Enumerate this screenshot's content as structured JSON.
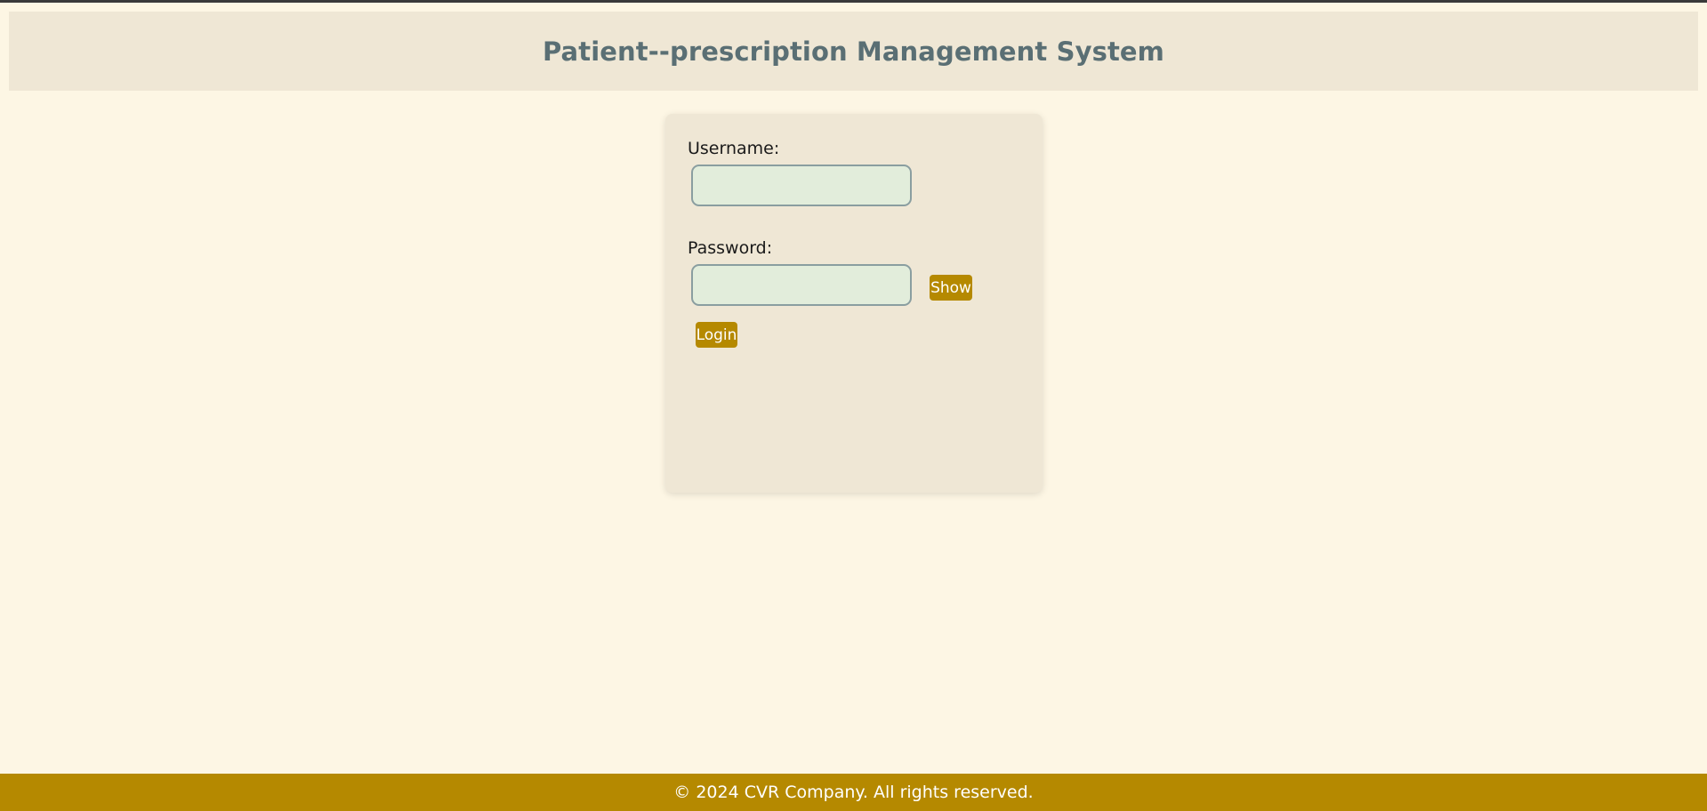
{
  "header": {
    "title": "Patient--prescription Management System"
  },
  "login": {
    "username_label": "Username:",
    "username_value": "",
    "password_label": "Password:",
    "password_value": "",
    "show_label": "Show",
    "login_label": "Login"
  },
  "footer": {
    "copyright": "© 2024 CVR Company. All rights reserved."
  },
  "colors": {
    "page_background": "#fdf6e4",
    "panel_background": "#efe7d5",
    "accent": "#b58900",
    "title_color": "#5a6f74",
    "input_background": "#e2eddb"
  }
}
